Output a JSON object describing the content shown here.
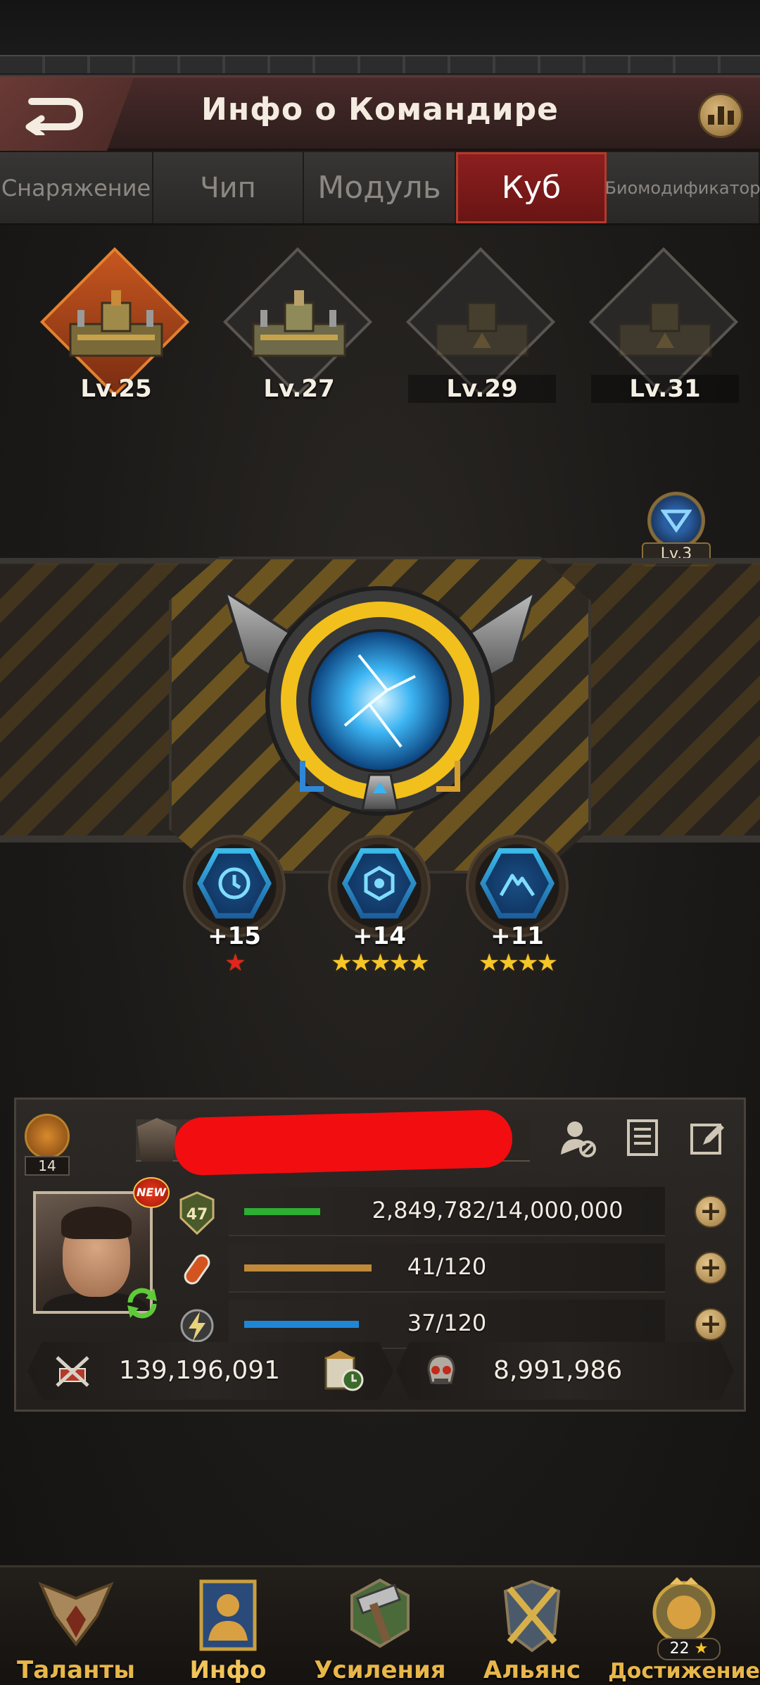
{
  "header": {
    "title": "Инфо о Командире"
  },
  "tabs": [
    {
      "label": "Снаряжение",
      "active": false
    },
    {
      "label": "Чип",
      "active": false
    },
    {
      "label": "Модуль",
      "active": false
    },
    {
      "label": "Куб",
      "active": true
    },
    {
      "label": "Биомодификатор",
      "active": false
    }
  ],
  "cubes": [
    {
      "level": "Lv.25",
      "state": "active"
    },
    {
      "level": "Lv.27",
      "state": "unlocked"
    },
    {
      "level": "Lv.29",
      "state": "locked"
    },
    {
      "level": "Lv.31",
      "state": "locked"
    }
  ],
  "core_badge": {
    "level": "Lv.3"
  },
  "skills": [
    {
      "value": "+15",
      "stars": "★",
      "star_color": "red",
      "icon": "clock-cycle-icon"
    },
    {
      "value": "+14",
      "stars": "★★★★★",
      "star_color": "gold",
      "icon": "hexagon-target-icon"
    },
    {
      "value": "+11",
      "stars": "★★★★",
      "star_color": "gold",
      "icon": "mountain-peak-icon"
    }
  ],
  "commander": {
    "rank_number": "14",
    "new_badge": "NEW",
    "level": "47",
    "exp": {
      "text": "2,849,782/14,000,000",
      "fraction": 0.2036
    },
    "stamina": {
      "text": "41/120",
      "fraction": 0.342
    },
    "energy": {
      "text": "37/120",
      "fraction": 0.308
    },
    "power": "139,196,091",
    "kills": "8,991,986"
  },
  "colors": {
    "exp_bar": "#2eae33",
    "stamina_bar": "#c08a3a",
    "energy_bar": "#1f86d6",
    "active_tab": "#8c1f1f",
    "nav_label": "#e8b64a",
    "redaction": "#f20d10"
  },
  "bottom_nav": [
    {
      "label": "Таланты",
      "icon": "eagle-wings-icon"
    },
    {
      "label": "Инфо",
      "icon": "commander-profile-icon"
    },
    {
      "label": "Усиления",
      "icon": "hammer-icon"
    },
    {
      "label": "Альянс",
      "icon": "crossed-swords-icon"
    },
    {
      "label": "Достижение",
      "icon": "lion-trophy-icon",
      "count": "22"
    }
  ]
}
